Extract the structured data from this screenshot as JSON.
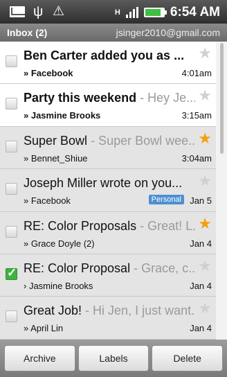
{
  "status_bar": {
    "icons": [
      "mail-icon",
      "usb-icon",
      "warning-icon"
    ],
    "network": "H",
    "time": "6:54 AM"
  },
  "account_bar": {
    "folder": "Inbox (2)",
    "account": "jsinger2010@gmail.com"
  },
  "messages": [
    {
      "subject": "Ben Carter added you as ...",
      "snippet": "",
      "from": "» Facebook",
      "date": "4:01am",
      "starred": false,
      "unread": true,
      "checked": false,
      "label": ""
    },
    {
      "subject": "Party this weekend",
      "snippet": " - Hey Je...",
      "from": "» Jasmine Brooks",
      "date": "3:15am",
      "starred": false,
      "unread": true,
      "checked": false,
      "label": ""
    },
    {
      "subject": "Super Bowl",
      "snippet": " - Super Bowl wee...",
      "from": "» Bennet_Shiue",
      "date": "3:04am",
      "starred": true,
      "unread": false,
      "checked": false,
      "label": ""
    },
    {
      "subject": "Joseph Miller wrote on you...",
      "snippet": "",
      "from": "» Facebook",
      "date": "Jan 5",
      "starred": false,
      "unread": false,
      "checked": false,
      "label": "Personal"
    },
    {
      "subject": "RE: Color Proposals",
      "snippet": " - Great! L...",
      "from": "» Grace Doyle (2)",
      "date": "Jan 4",
      "starred": true,
      "unread": false,
      "checked": false,
      "label": ""
    },
    {
      "subject": "RE: Color Proposal",
      "snippet": " - Grace, c...",
      "from": "› Jasmine Brooks",
      "date": "Jan 4",
      "starred": false,
      "unread": false,
      "checked": true,
      "label": ""
    },
    {
      "subject": "Great Job!",
      "snippet": " - Hi Jen, I just want...",
      "from": "» April Lin",
      "date": "Jan 4",
      "starred": false,
      "unread": false,
      "checked": false,
      "label": ""
    }
  ],
  "actions": {
    "archive": "Archive",
    "labels": "Labels",
    "delete": "Delete"
  },
  "colors": {
    "star_on": "#f3a10b",
    "checked": "#3fb23f",
    "label_chip": "#4d8fd1"
  }
}
